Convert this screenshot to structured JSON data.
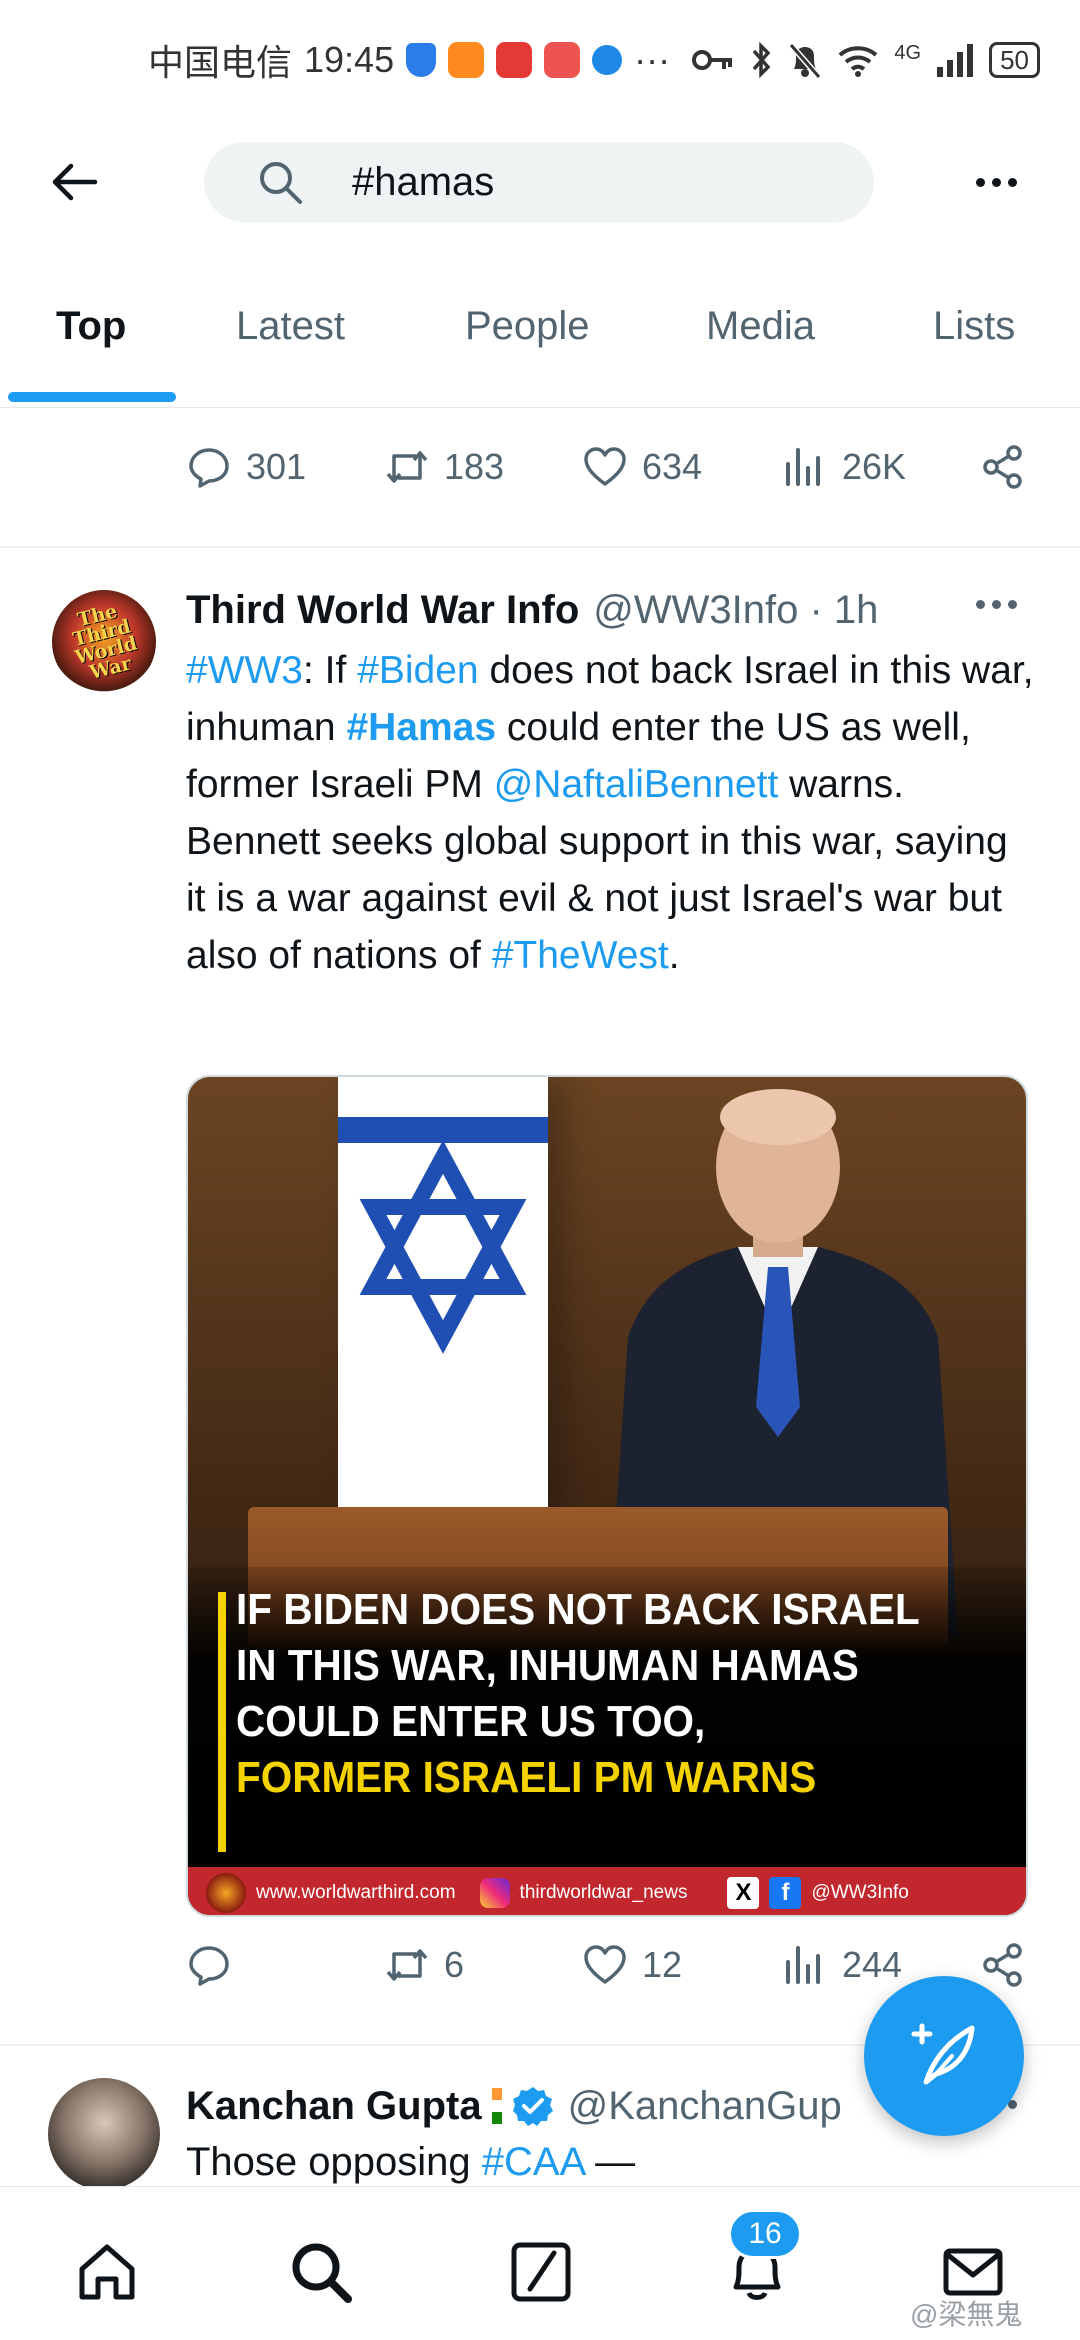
{
  "status_bar": {
    "carrier": "中国电信",
    "time": "19:45",
    "more": "···",
    "network": "4G",
    "battery": "50"
  },
  "header": {
    "search_query": "#hamas"
  },
  "tabs": [
    "Top",
    "Latest",
    "People",
    "Media",
    "Lists"
  ],
  "active_tab": "Top",
  "previous_tweet": {
    "replies": "301",
    "retweets": "183",
    "likes": "634",
    "views": "26K"
  },
  "tweet": {
    "name": "Third World War Info",
    "handle": "@WW3Info · 1h",
    "avatar_text": "The Third World War",
    "body": {
      "t1": "#WW3",
      "t2": ": If ",
      "t3": "#Biden",
      "t4": " does not back Israel in this war, inhuman ",
      "t5": "#Hamas",
      "t6": " could enter the US as well, former Israeli PM ",
      "t7": "@NaftaliBennett",
      "t8": " warns. Bennett seeks global support in this war, saying it is a war against evil & not just Israel's war but also of nations of ",
      "t9": "#TheWest",
      "t10": "."
    },
    "media": {
      "caption_white": "IF BIDEN DOES NOT BACK ISRAEL IN THIS WAR, INHUMAN HAMAS COULD ENTER US TOO,",
      "caption_yellow": "FORMER ISRAELI PM WARNS",
      "footer_site": "www.worldwarthird.com",
      "footer_instagram": "thirdworldwar_news",
      "footer_handle": "@WW3Info"
    },
    "retweets": "6",
    "likes": "12",
    "views": "244"
  },
  "next_tweet": {
    "name": "Kanchan Gupta",
    "handle": "@KanchanGup",
    "body_prefix": "Those opposing ",
    "body_tag": "#CAA",
    "body_suffix": " —"
  },
  "bottom_nav": {
    "notification_count": "16"
  },
  "watermark": "@梁無鬼",
  "colors": {
    "accent": "#1d9bf0",
    "text": "#0f1419",
    "muted": "#536471",
    "caption_yellow": "#f5d300",
    "footer_red": "#c1272d"
  },
  "icons": [
    "back-arrow-icon",
    "search-icon",
    "more-icon",
    "reply-icon",
    "retweet-icon",
    "like-icon",
    "views-icon",
    "share-icon",
    "compose-icon",
    "home-icon",
    "explore-icon",
    "grok-icon",
    "notifications-icon",
    "messages-icon",
    "verified-icon"
  ]
}
